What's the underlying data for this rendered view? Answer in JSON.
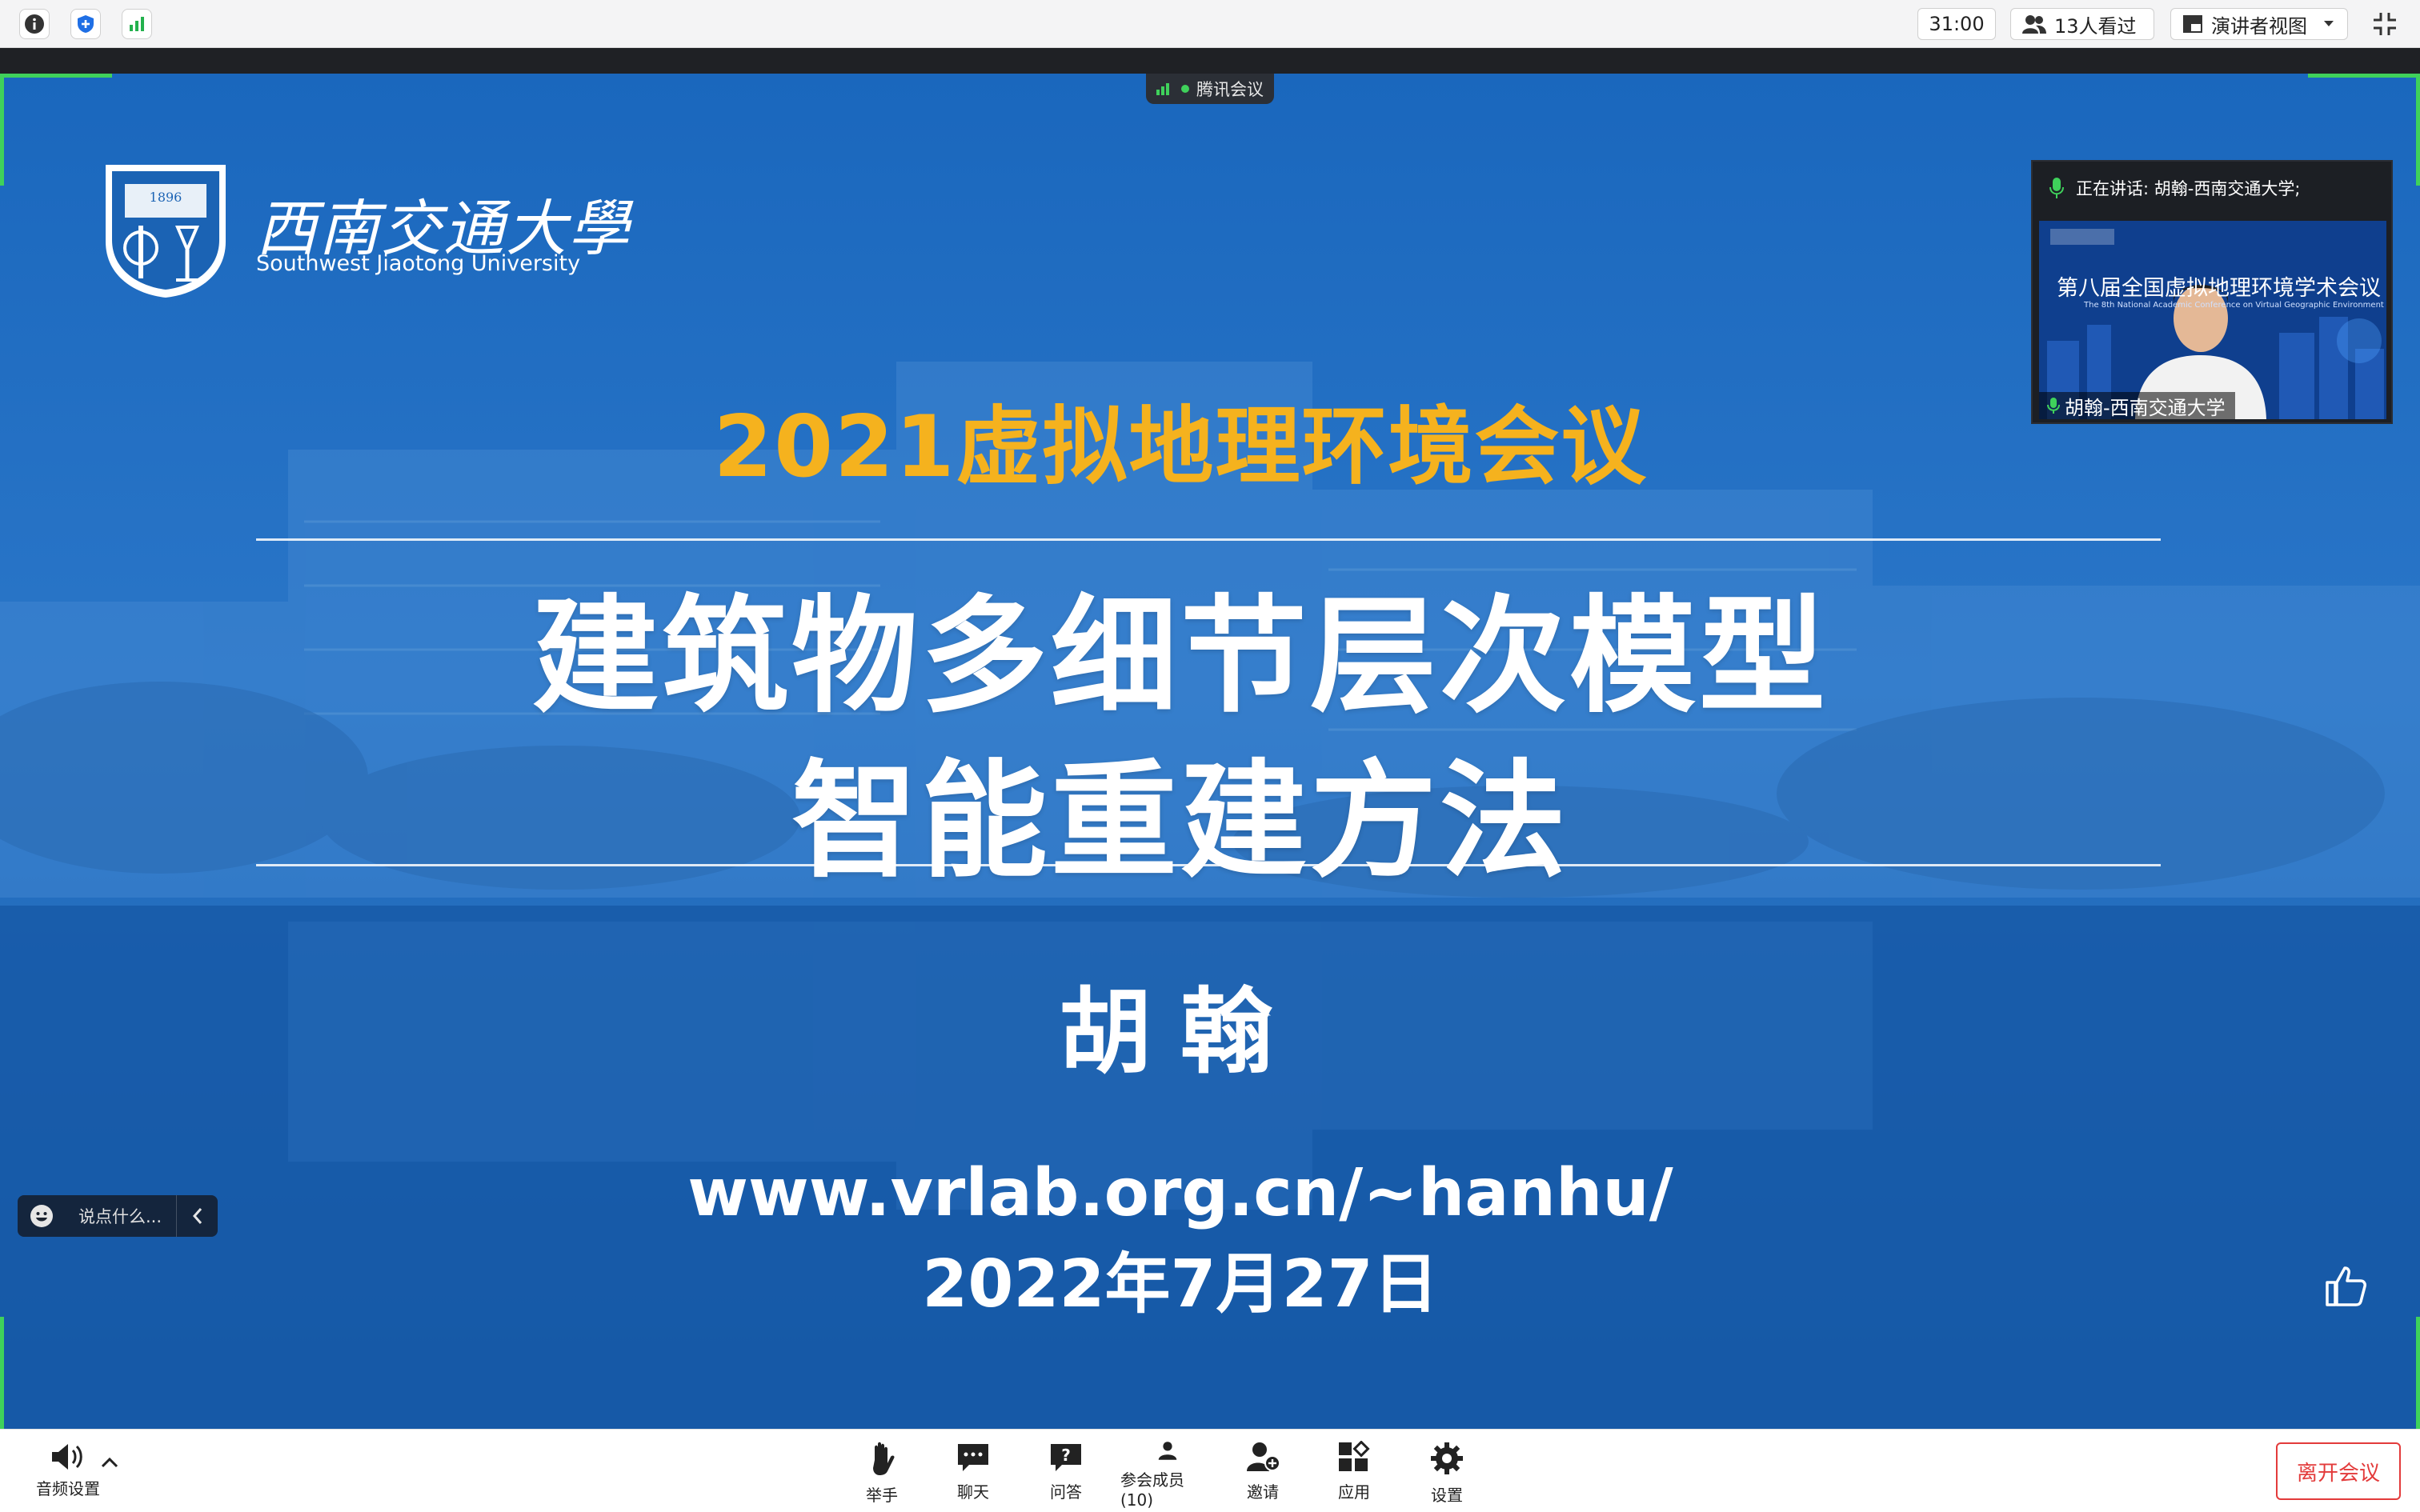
{
  "topbar": {
    "timer": "31:00",
    "viewers": "13人看过",
    "view_mode": "演讲者视图"
  },
  "meeting": {
    "app_label": "腾讯会议"
  },
  "slide": {
    "logo_cn": "西南交通大學",
    "logo_en": "Southwest Jiaotong University",
    "emblem_text": "1896",
    "conference_title": "2021虚拟地理环境会议",
    "title_line1": "建筑物多细节层次模型",
    "title_line2": "智能重建方法",
    "author": "胡翰",
    "url": "www.vrlab.org.cn/~hanhu/",
    "date": "2022年7月27日"
  },
  "speaker": {
    "speaking_label": "正在讲话: 胡翰-西南交通大学;",
    "video_title": "第八届全国虚拟地理环境学术会议",
    "video_subtitle": "The 8th National Academic Conference on Virtual Geographic Environment",
    "name_tag": "胡翰-西南交通大学"
  },
  "chat": {
    "placeholder": "说点什么..."
  },
  "toolbar": {
    "audio_label": "音频设置",
    "items": [
      {
        "label": "举手",
        "icon": "raise-hand-icon"
      },
      {
        "label": "聊天",
        "icon": "chat-icon"
      },
      {
        "label": "问答",
        "icon": "question-icon"
      },
      {
        "label": "参会成员(10)",
        "icon": "participants-icon"
      },
      {
        "label": "邀请",
        "icon": "invite-icon"
      },
      {
        "label": "应用",
        "icon": "apps-icon"
      },
      {
        "label": "设置",
        "icon": "settings-icon"
      }
    ],
    "leave_label": "离开会议"
  },
  "colors": {
    "accent_gold": "#f5b21e",
    "stage_blue": "#1b63b4",
    "leave_red": "#e33b3b",
    "corner_green": "#3fd15b"
  }
}
